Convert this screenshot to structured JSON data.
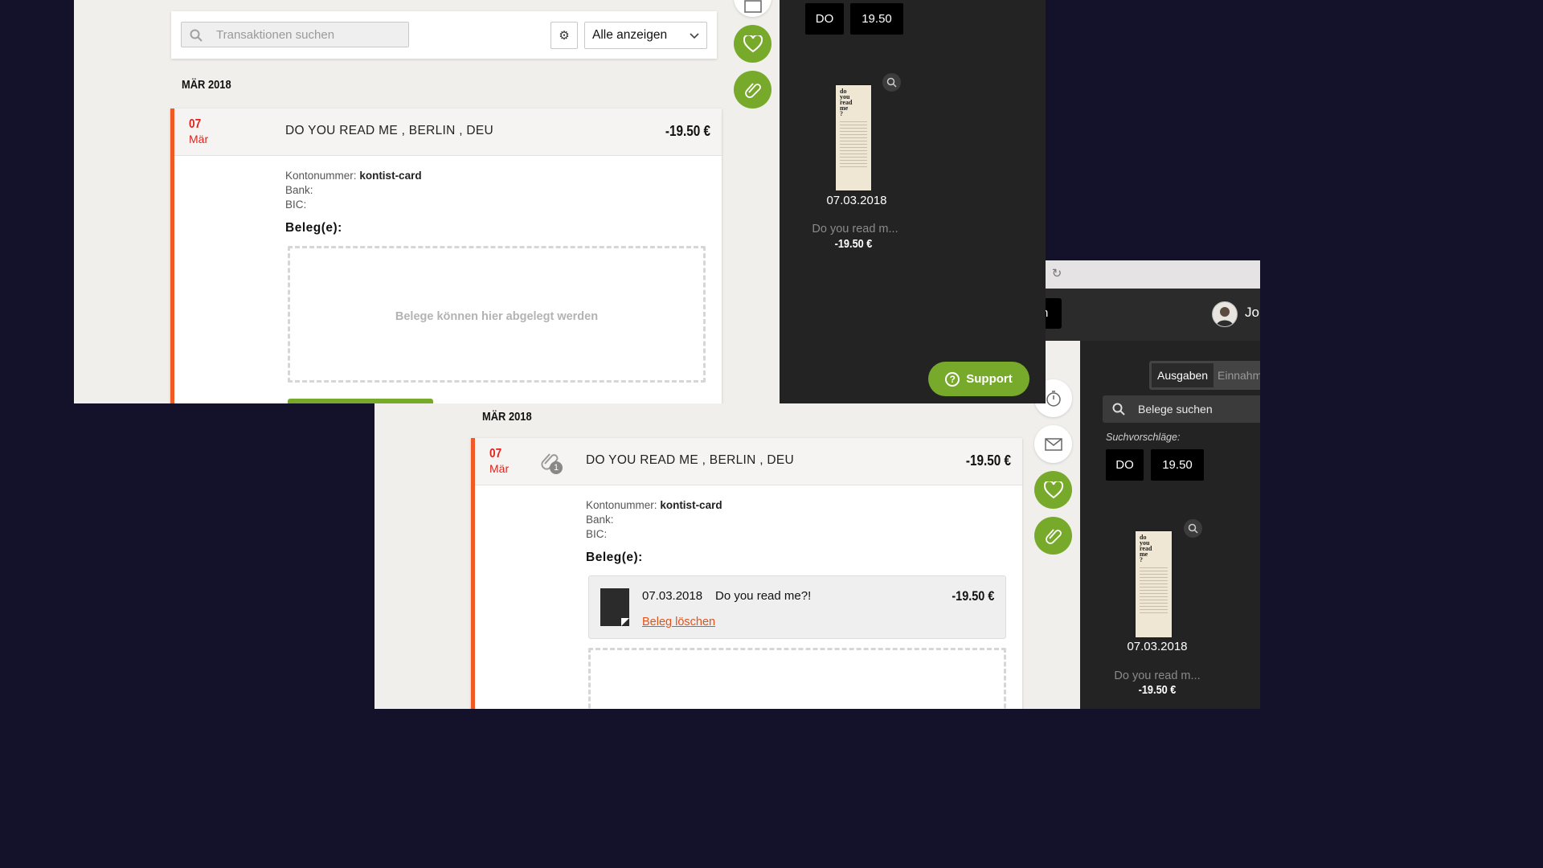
{
  "back_window": {
    "header": {
      "dark_button_text": "n",
      "username": "Jo"
    },
    "month_header": "MÄR 2018",
    "transaction": {
      "day": "07",
      "month": "Mär",
      "attachment_count": "1",
      "merchant": "DO YOU READ ME , BERLIN , DEU",
      "amount": "-19.50 €",
      "account_label": "Kontonummer:",
      "account_value": "kontist-card",
      "bank_label": "Bank:",
      "bic_label": "BIC:",
      "receipts_label": "Beleg(e):",
      "receipt": {
        "date": "07.03.2018",
        "name": "Do you read me?!",
        "amount": "-19.50 €",
        "delete_link": "Beleg löschen"
      }
    },
    "sidebar": {
      "tabs": [
        "Ausgaben",
        "Einnahme"
      ],
      "search_placeholder": "Belege suchen",
      "suggestions_label": "Suchvorschläge:",
      "chips": [
        "DO",
        "19.50"
      ],
      "thumbnail": {
        "date": "07.03.2018",
        "name": "Do you read m...",
        "amount": "-19.50 €"
      }
    }
  },
  "front_window": {
    "search": {
      "placeholder": "Transaktionen suchen"
    },
    "filter_value": "Alle anzeigen",
    "month_header": "MÄR 2018",
    "transaction": {
      "day": "07",
      "month": "Mär",
      "merchant": "DO YOU READ ME , BERLIN , DEU",
      "amount": "-19.50 €",
      "account_label": "Kontonummer:",
      "account_value": "kontist-card",
      "bank_label": "Bank:",
      "bic_label": "BIC:",
      "receipts_label": "Beleg(e):",
      "dropzone_text": "Belege können hier abgelegt werden"
    },
    "sidebar": {
      "chips": [
        "DO",
        "19.50"
      ],
      "thumbnail": {
        "date": "07.03.2018",
        "name": "Do you read m...",
        "amount": "-19.50 €"
      }
    },
    "support_label": "Support"
  },
  "colors": {
    "accent_green": "#77aa2a",
    "accent_red": "#e4221c",
    "card_border_orange": "#f15a24",
    "dark_panel": "#232323",
    "desktop": "#14112a"
  }
}
